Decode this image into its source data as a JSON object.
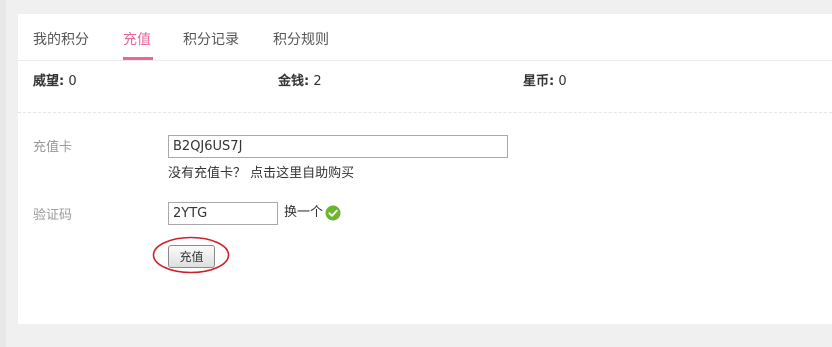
{
  "tabs": [
    {
      "label": "我的积分",
      "active": false
    },
    {
      "label": "充值",
      "active": true
    },
    {
      "label": "积分记录",
      "active": false
    },
    {
      "label": "积分规则",
      "active": false
    }
  ],
  "stats": [
    {
      "label": "威望:",
      "value": "0"
    },
    {
      "label": "金钱:",
      "value": "2"
    },
    {
      "label": "星币:",
      "value": "0"
    }
  ],
  "form": {
    "card_label": "充值卡",
    "card_value": "B2QJ6US7J",
    "card_hint": "没有充值卡？ 点击这里自助购买",
    "captcha_label": "验证码",
    "captcha_value": "2YTG",
    "captcha_refresh": "换一个",
    "submit_label": "充值"
  },
  "colors": {
    "accent": "#e8669b",
    "annotation_circle": "#d0202a",
    "success": "#6cb52c"
  },
  "icons": {
    "captcha_status": "check-circle-icon"
  }
}
